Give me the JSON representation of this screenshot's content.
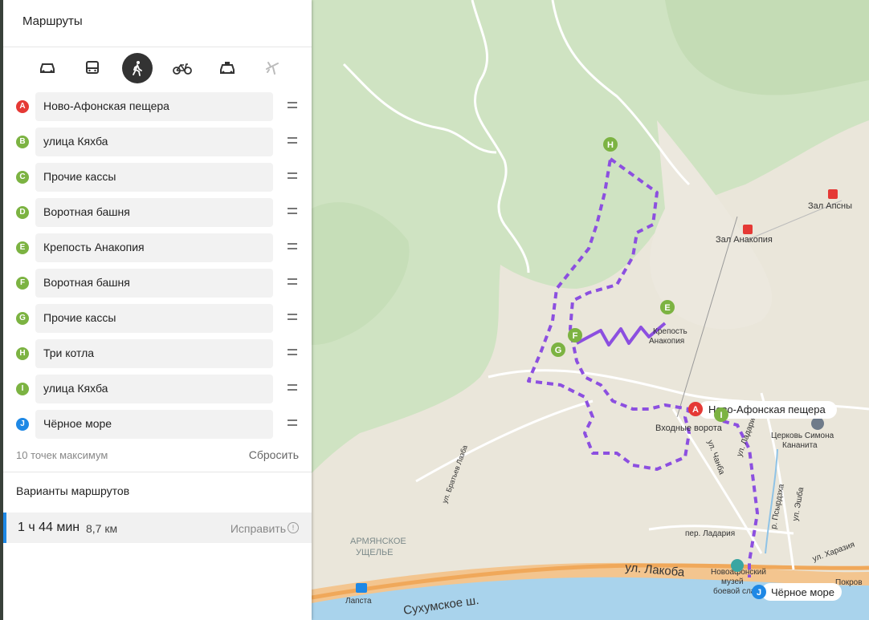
{
  "panel": {
    "title": "Маршруты",
    "modes": [
      {
        "icon": "car-icon",
        "active": false
      },
      {
        "icon": "bus-icon",
        "active": false
      },
      {
        "icon": "walk-icon",
        "active": true
      },
      {
        "icon": "bike-icon",
        "active": false
      },
      {
        "icon": "taxi-icon",
        "active": false
      },
      {
        "icon": "plane-icon",
        "active": false
      }
    ],
    "points": [
      {
        "letter": "A",
        "name": "Ново-Афонская пещера",
        "color": "#e53935"
      },
      {
        "letter": "B",
        "name": "улица Кяхба",
        "color": "#7cb342"
      },
      {
        "letter": "C",
        "name": "Прочие кассы",
        "color": "#7cb342"
      },
      {
        "letter": "D",
        "name": "Воротная башня",
        "color": "#7cb342"
      },
      {
        "letter": "E",
        "name": "Крепость Анакопия",
        "color": "#7cb342"
      },
      {
        "letter": "F",
        "name": "Воротная башня",
        "color": "#7cb342"
      },
      {
        "letter": "G",
        "name": "Прочие кассы",
        "color": "#7cb342"
      },
      {
        "letter": "H",
        "name": "Три котла",
        "color": "#7cb342"
      },
      {
        "letter": "I",
        "name": "улица Кяхба",
        "color": "#7cb342"
      },
      {
        "letter": "J",
        "name": "Чёрное море",
        "color": "#1e88e5"
      }
    ],
    "max_points": "10 точек максимум",
    "reset": "Сбросить",
    "variants_title": "Варианты маршрутов",
    "route": {
      "time": "1 ч 44 мин",
      "distance": "8,7 км",
      "fix": "Исправить",
      "accent": "#1e88e5"
    }
  },
  "map": {
    "route_color": "#8c4fe0",
    "markers": [
      {
        "letter": "A",
        "label": "Ново-Афонская пещера",
        "color": "#e53935"
      },
      {
        "letter": "E",
        "color": "#7cb342"
      },
      {
        "letter": "F",
        "color": "#7cb342"
      },
      {
        "letter": "G",
        "color": "#7cb342"
      },
      {
        "letter": "H",
        "color": "#7cb342"
      },
      {
        "letter": "I",
        "color": "#7cb342"
      },
      {
        "letter": "J",
        "label": "Чёрное море",
        "color": "#1e88e5"
      }
    ],
    "labels": {
      "zal_apsny": "Зал Апсны",
      "zal_anakopia": "Зал Анакопия",
      "krepost_1": "Крепость",
      "krepost_2": "Анакопия",
      "vhodnye_vorota": "Входные ворота",
      "church_1": "Церковь Симона",
      "church_2": "Кананита",
      "armyanskoe_1": "АРМЯНСКОЕ",
      "armyanskoe_2": "УЩЕЛЬЕ",
      "ul_lakoba": "ул. Лакоба",
      "sukhumskoe": "Сухумское ш.",
      "lapsta": "Лапста",
      "per_ladaria": "пер. Ладария",
      "ul_ladaria": "ул. Ладария",
      "r_psyrdzha": "р. Псырдзха",
      "ul_chanba": "ул. Чанба",
      "ul_bratiev_lazba": "ул. Братьев Лазба",
      "ul_eshba": "ул. Эшба",
      "ul_kharazia": "ул. Харазия",
      "museum_1": "Новоафонский",
      "museum_2": "музей",
      "museum_3": "боевой славы",
      "pokrov": "Покров"
    }
  }
}
